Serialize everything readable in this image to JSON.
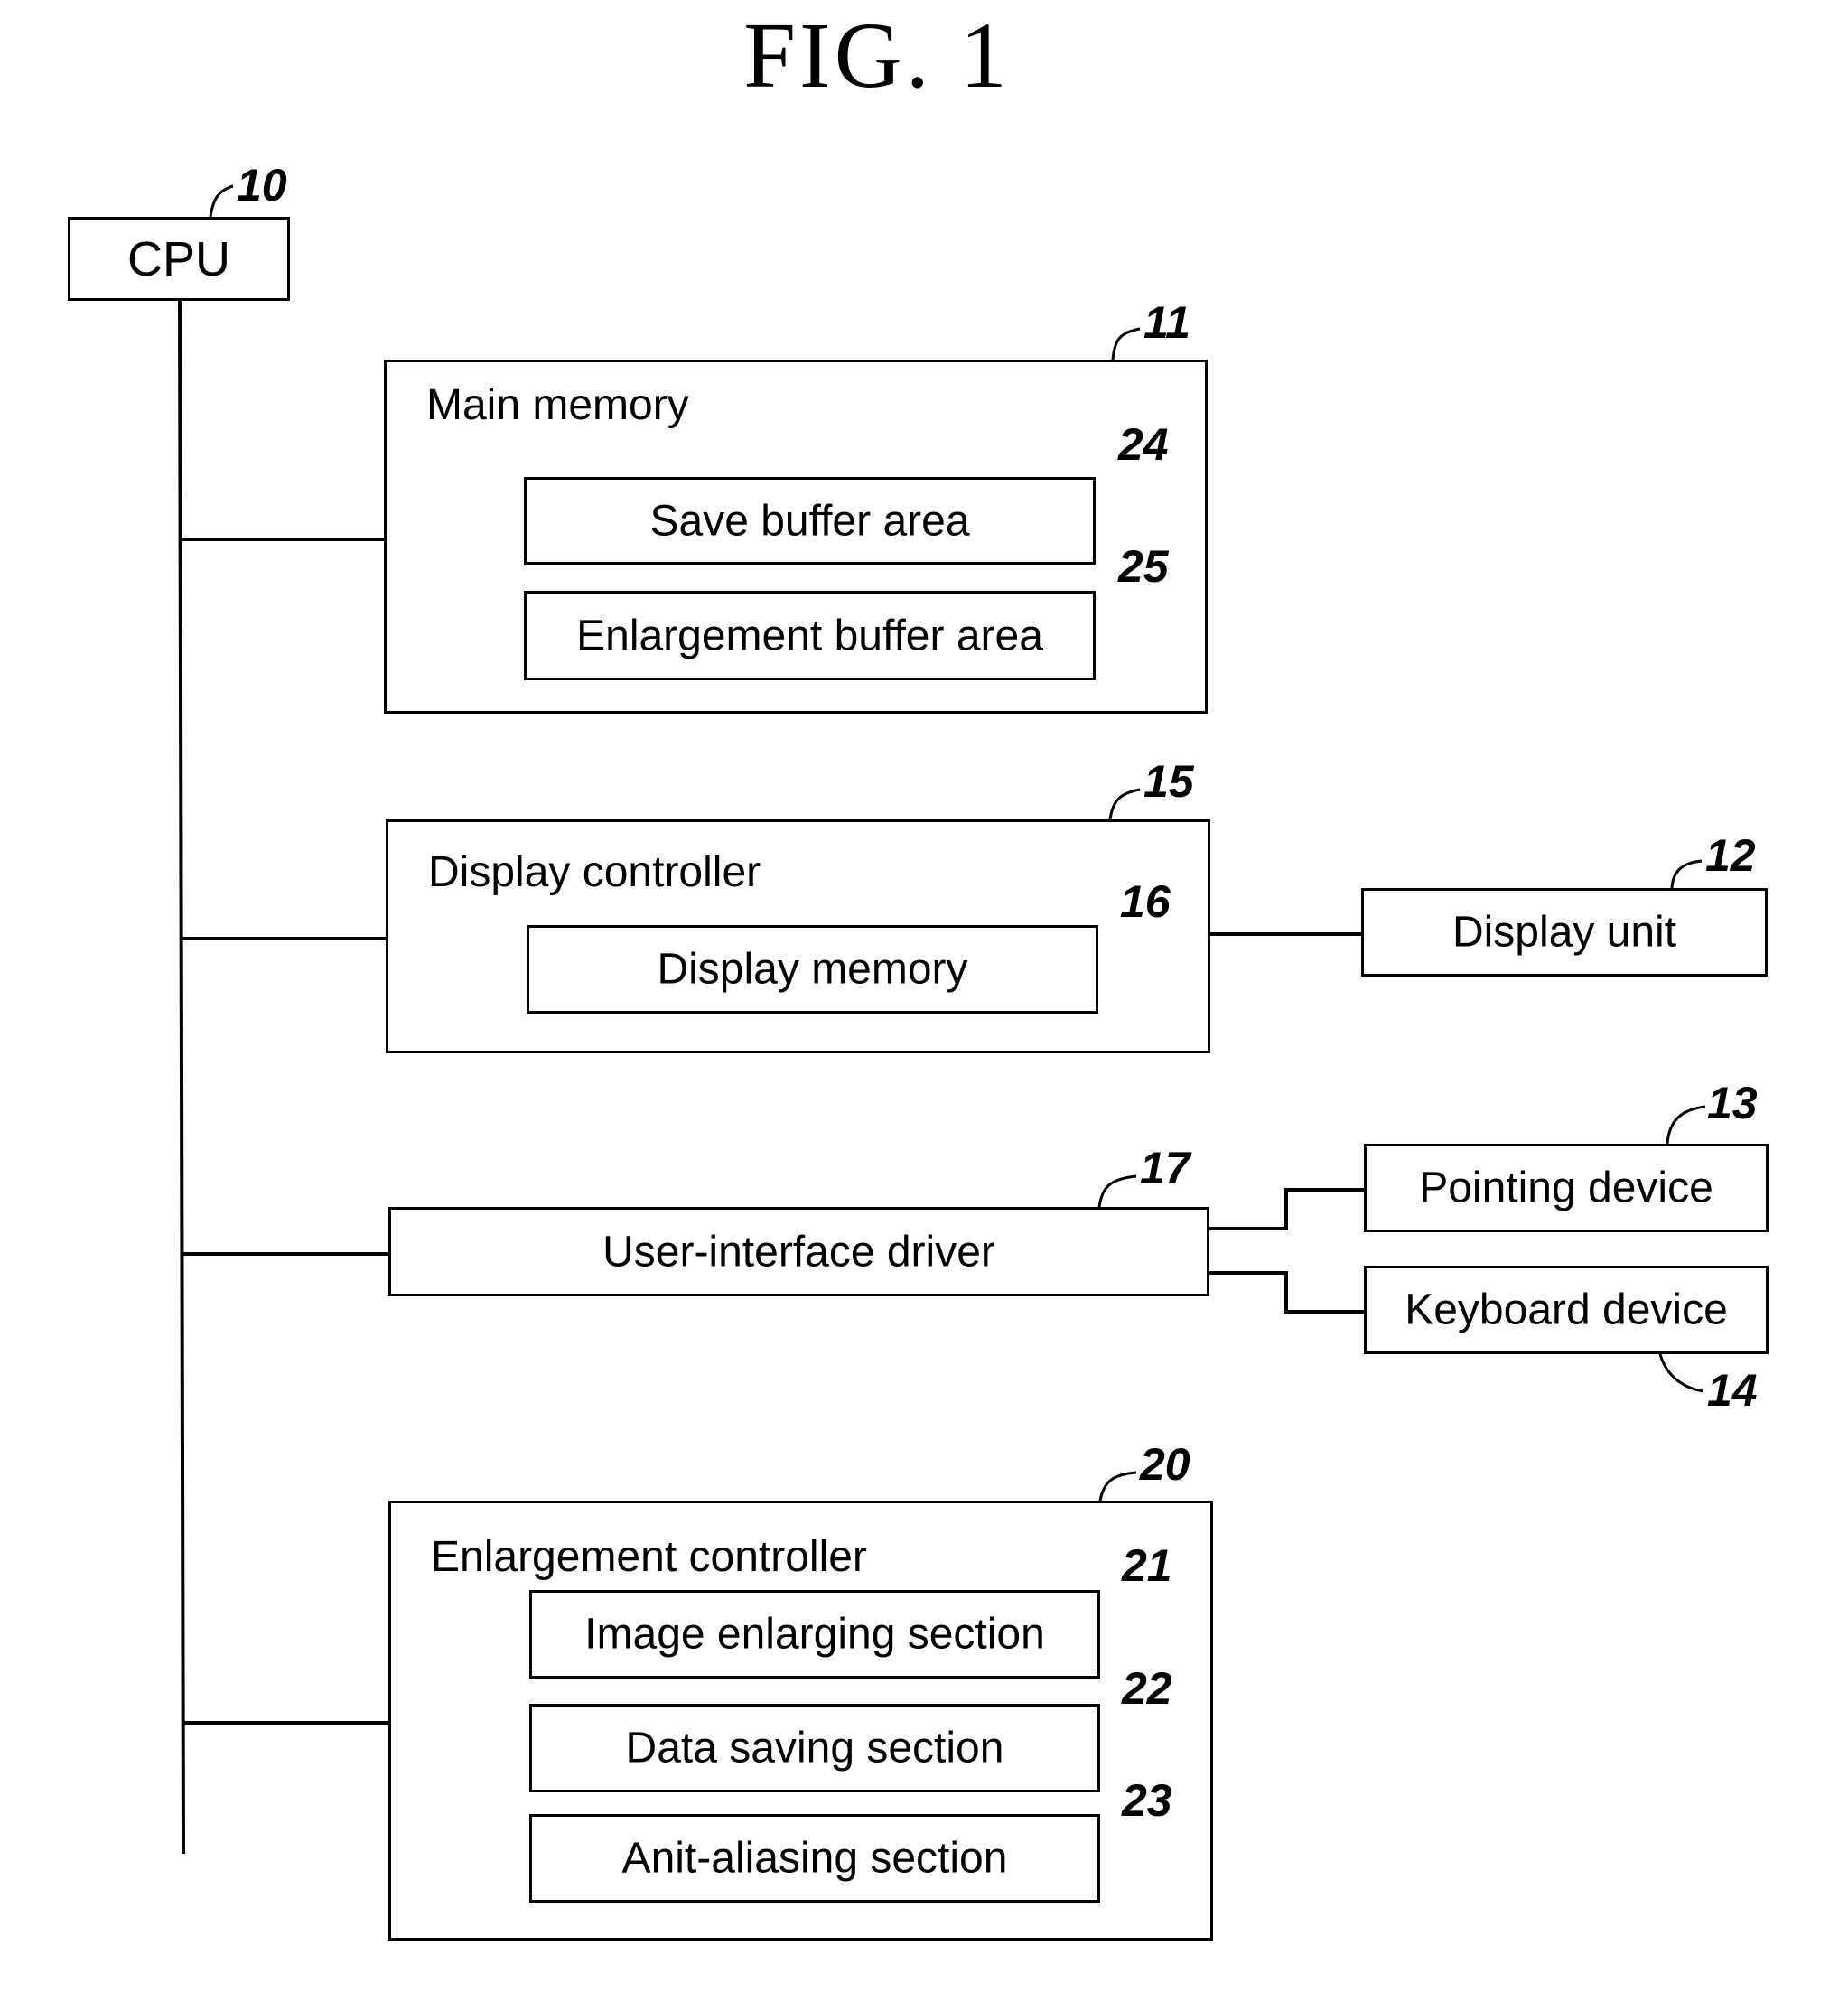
{
  "figure": {
    "title": "FIG. 1"
  },
  "blocks": {
    "cpu": {
      "label": "CPU",
      "ref": "10"
    },
    "main_memory": {
      "label": "Main memory",
      "ref": "11",
      "children": [
        {
          "label": "Save buffer area",
          "ref": "24"
        },
        {
          "label": "Enlargement buffer area",
          "ref": "25"
        }
      ]
    },
    "display_controller": {
      "label": "Display controller",
      "ref": "15",
      "children": [
        {
          "label": "Display memory",
          "ref": "16"
        }
      ]
    },
    "display_unit": {
      "label": "Display unit",
      "ref": "12"
    },
    "ui_driver": {
      "label": "User-interface driver",
      "ref": "17"
    },
    "pointing_device": {
      "label": "Pointing device",
      "ref": "13"
    },
    "keyboard_device": {
      "label": "Keyboard device",
      "ref": "14"
    },
    "enlargement_controller": {
      "label": "Enlargement controller",
      "ref": "20",
      "children": [
        {
          "label": "Image enlarging section",
          "ref": "21"
        },
        {
          "label": "Data saving section",
          "ref": "22"
        },
        {
          "label": "Anit-aliasing section",
          "ref": "23"
        }
      ]
    }
  }
}
